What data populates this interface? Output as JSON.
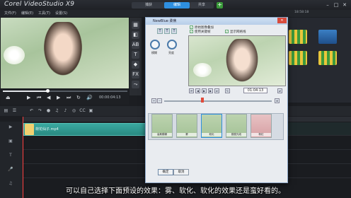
{
  "app": {
    "title": "Corel VideoStudio X9",
    "steps": {
      "capture": "捕获",
      "edit": "编辑",
      "share": "共享"
    },
    "status_right": "18:58:18",
    "menus": [
      "文件(F)",
      "编辑(E)",
      "工具(T)",
      "设置(S)"
    ]
  },
  "playback": {
    "timecode": "00:00:04:13",
    "progress": 0.36
  },
  "timeline": {
    "clip_label": "荷花仙子.mp4"
  },
  "dialog": {
    "title": "NewBlue 柔焦",
    "checks": [
      "原始图像叠加",
      "使用关键帧",
      "显示网格线"
    ],
    "knob_labels": [
      "模糊",
      "亮度"
    ],
    "time": "01:04:13",
    "ok": "确定",
    "cancel": "取消",
    "presets": [
      "高斯模糊",
      "雾",
      "软化",
      "朦胧光线",
      "粉红"
    ]
  },
  "subtitle": "可以自己选择下面预设的效果：雾、软化、软化的效果还是蛮好看的。",
  "colors": {
    "accent": "#2e8fe0",
    "clip": "#3aa9a0",
    "playhead": "#ff4040"
  }
}
